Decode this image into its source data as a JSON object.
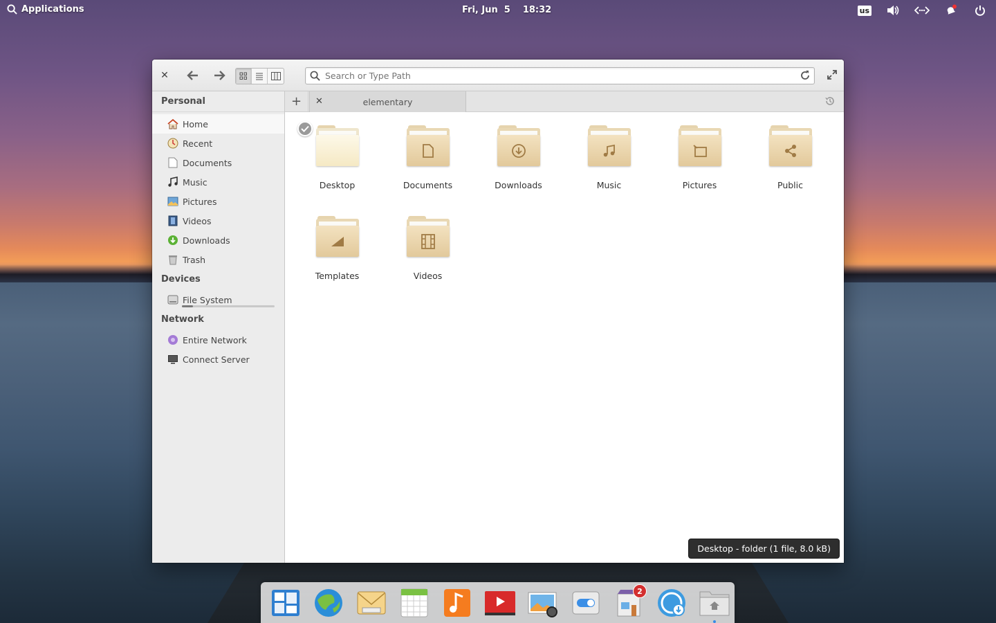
{
  "panel": {
    "applications_label": "Applications",
    "date": "Fri, Jun  5",
    "time": "18:32",
    "keyboard_layout": "us"
  },
  "window": {
    "search_placeholder": "Search or Type Path",
    "tab_label": "elementary",
    "view_modes": [
      "grid-view-icon",
      "list-view-icon",
      "column-view-icon"
    ],
    "active_view": "grid-view-icon"
  },
  "sidebar": {
    "personal_header": "Personal",
    "personal_items": [
      {
        "label": "Home",
        "icon": "home-icon"
      },
      {
        "label": "Recent",
        "icon": "recent-icon"
      },
      {
        "label": "Documents",
        "icon": "document-icon"
      },
      {
        "label": "Music",
        "icon": "music-icon"
      },
      {
        "label": "Pictures",
        "icon": "pictures-icon"
      },
      {
        "label": "Videos",
        "icon": "videos-icon"
      },
      {
        "label": "Downloads",
        "icon": "downloads-icon"
      },
      {
        "label": "Trash",
        "icon": "trash-icon"
      }
    ],
    "devices_header": "Devices",
    "devices_items": [
      {
        "label": "File System",
        "icon": "drive-icon",
        "usage_fraction": 0.12
      }
    ],
    "network_header": "Network",
    "network_items": [
      {
        "label": "Entire Network",
        "icon": "network-icon"
      },
      {
        "label": "Connect Server",
        "icon": "server-icon"
      }
    ]
  },
  "content": {
    "items": [
      {
        "label": "Desktop",
        "emblem": "none"
      },
      {
        "label": "Documents",
        "emblem": "document"
      },
      {
        "label": "Downloads",
        "emblem": "download"
      },
      {
        "label": "Music",
        "emblem": "music"
      },
      {
        "label": "Pictures",
        "emblem": "pictures"
      },
      {
        "label": "Public",
        "emblem": "share"
      },
      {
        "label": "Templates",
        "emblem": "template"
      },
      {
        "label": "Videos",
        "emblem": "video"
      }
    ],
    "tooltip": "Desktop - folder (1 file, 8.0 kB)"
  },
  "dock": {
    "apps": [
      "multitasking-view-icon",
      "web-browser-icon",
      "mail-icon",
      "calendar-icon",
      "music-app-icon",
      "videos-app-icon",
      "photos-app-icon",
      "settings-icon",
      "app-center-icon",
      "updates-icon",
      "files-icon"
    ],
    "appcenter_badge": "2"
  },
  "colors": {
    "accent": "#3689e6",
    "folder": "#e9d3a6",
    "badge": "#d32f2f"
  }
}
